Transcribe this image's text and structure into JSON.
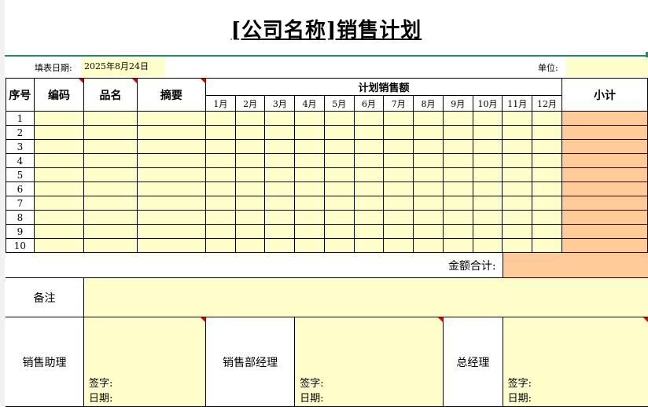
{
  "title": "[公司名称]销售计划",
  "form": {
    "date_label": "填表日期:",
    "date_value": "2025年8月24日",
    "unit_label": "单位:"
  },
  "table": {
    "headers": {
      "seq": "序号",
      "code": "编码",
      "product": "品名",
      "summary": "摘要",
      "planned_sales": "计划销售额",
      "subtotal": "小计"
    },
    "months": [
      "1月",
      "2月",
      "3月",
      "4月",
      "5月",
      "6月",
      "7月",
      "8月",
      "9月",
      "10月",
      "11月",
      "12月"
    ],
    "row_numbers": [
      "1",
      "2",
      "3",
      "4",
      "5",
      "6",
      "7",
      "8",
      "9",
      "10"
    ],
    "total_label": "金额合计:"
  },
  "remarks": {
    "label": "备注"
  },
  "signatures": {
    "sales_assistant": "销售助理",
    "sales_manager": "销售部经理",
    "general_manager": "总经理",
    "sign_label": "签字:",
    "date_label": "日期:"
  },
  "colors": {
    "input_fill": "#ffffcc",
    "subtotal_fill": "#ffcc99",
    "accent_line": "#1f8f5f",
    "comment_marker": "#e00000"
  }
}
